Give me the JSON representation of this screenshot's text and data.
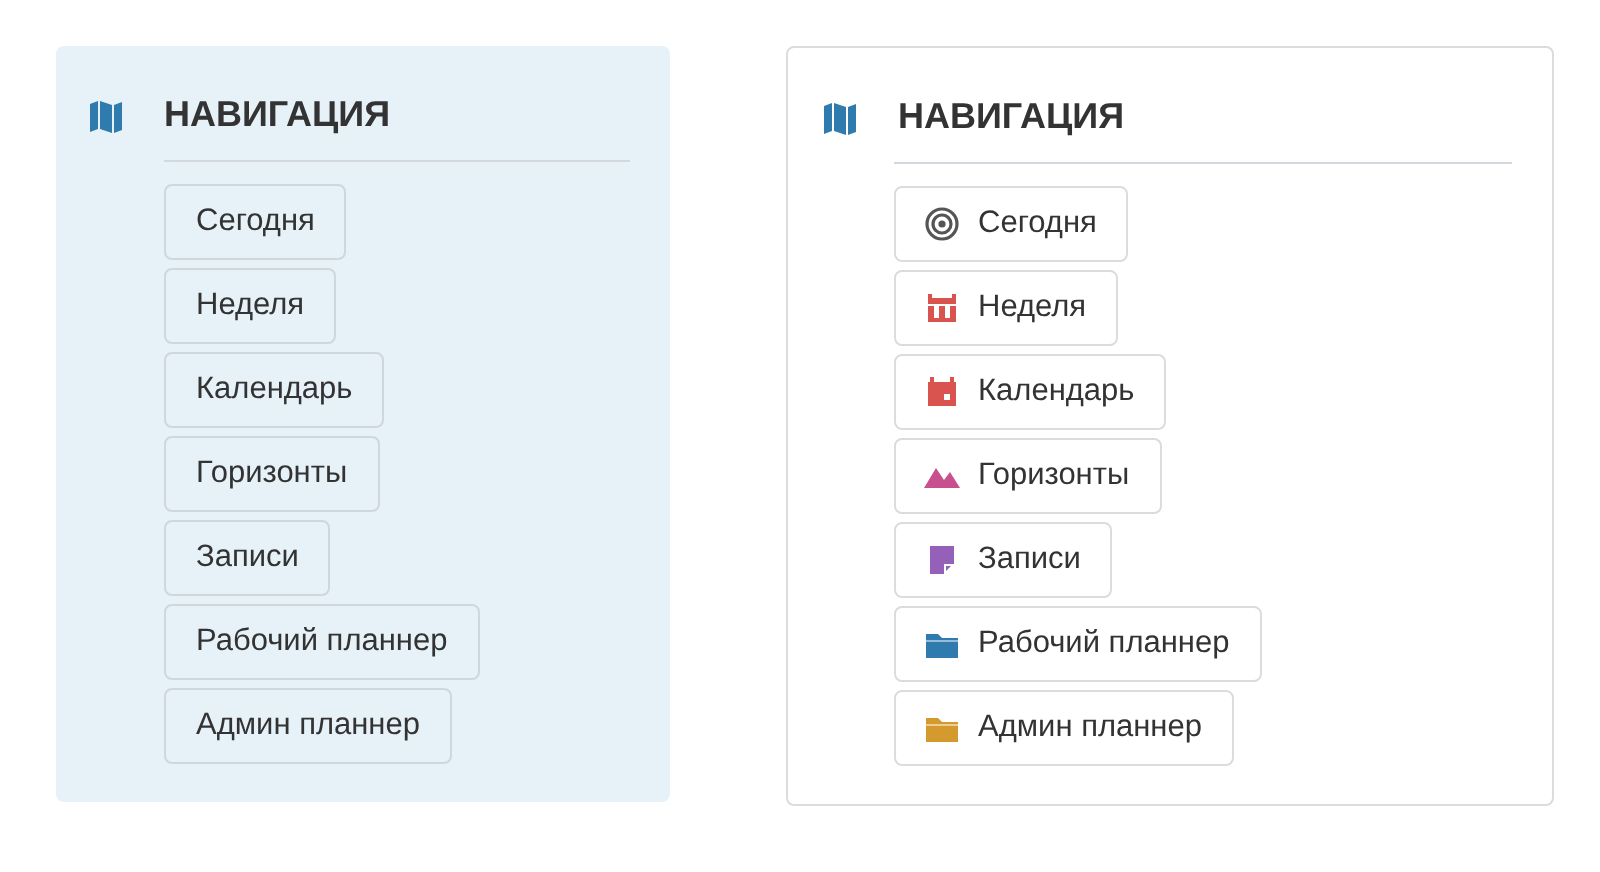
{
  "panels": [
    {
      "kind": "tinted",
      "heading": "НАВИГАЦИЯ",
      "items": [
        {
          "label": "Сегодня"
        },
        {
          "label": "Неделя"
        },
        {
          "label": "Календарь"
        },
        {
          "label": "Горизонты"
        },
        {
          "label": "Записи"
        },
        {
          "label": "Рабочий планнер"
        },
        {
          "label": "Админ планнер"
        }
      ]
    },
    {
      "kind": "plain",
      "heading": "НАВИГАЦИЯ",
      "items": [
        {
          "label": "Сегодня",
          "kind": "target",
          "color": "#555555"
        },
        {
          "label": "Неделя",
          "kind": "week",
          "color": "#d9534f"
        },
        {
          "label": "Календарь",
          "kind": "calendar",
          "color": "#d9534f"
        },
        {
          "label": "Горизонты",
          "kind": "mountains",
          "color": "#c9508f"
        },
        {
          "label": "Записи",
          "kind": "note",
          "color": "#9561b8"
        },
        {
          "label": "Рабочий планнер",
          "kind": "folder",
          "color": "#2f7bad"
        },
        {
          "label": "Админ планнер",
          "kind": "folder",
          "color": "#d59a2e"
        }
      ]
    }
  ]
}
